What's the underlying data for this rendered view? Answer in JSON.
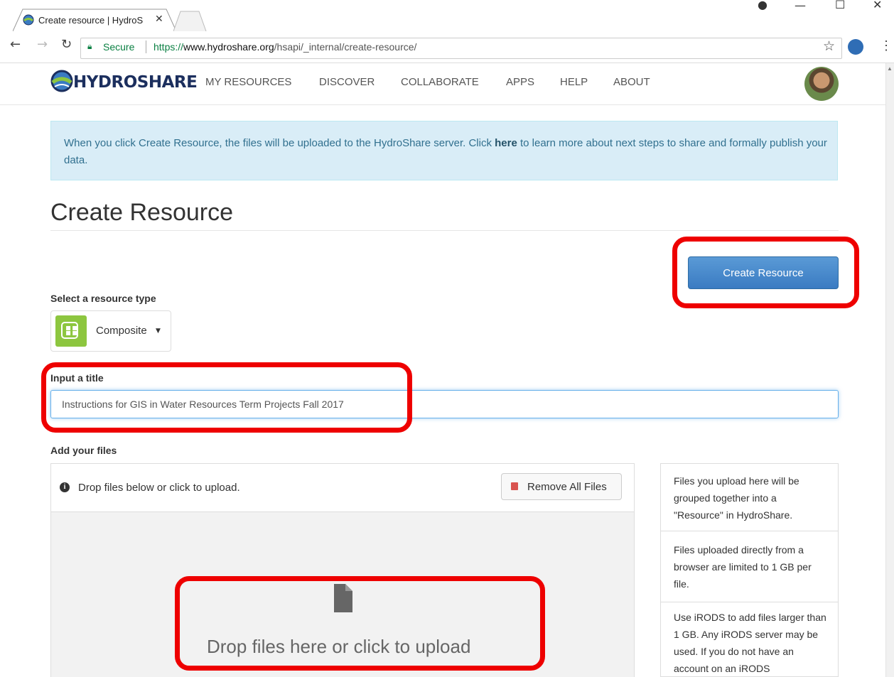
{
  "browser": {
    "tab_title": "Create resource | HydroS",
    "address_secure_label": "Secure",
    "url_scheme": "https://",
    "url_host": "www.hydroshare.org",
    "url_path": "/hsapi/_internal/create-resource/"
  },
  "site": {
    "logo_text": "HYDROSHARE",
    "nav": [
      "MY RESOURCES",
      "DISCOVER",
      "COLLABORATE",
      "APPS",
      "HELP",
      "ABOUT"
    ]
  },
  "alert": {
    "before_link": "When you click Create Resource, the files will be uploaded to the HydroShare server. Click ",
    "link": "here",
    "after_link": " to learn more about next steps to share and formally publish your data."
  },
  "page": {
    "title": "Create Resource",
    "create_button": "Create Resource",
    "resource_type_label": "Select a resource type",
    "resource_type_value": "Composite",
    "title_label": "Input a title",
    "title_value": "Instructions for GIS in Water Resources Term Projects Fall 2017",
    "files_label": "Add your files",
    "drop_hint": "Drop files below or click to upload.",
    "remove_all": "Remove All Files",
    "dropzone_text": "Drop files here or click to upload"
  },
  "side_notes": [
    "Files you upload here will be grouped together into a \"Resource\" in HydroShare.",
    "Files uploaded directly from a browser are limited to 1 GB per file.",
    "Use iRODS to add files larger than 1 GB. Any iRODS server may be used. If you do not have an account on an iRODS"
  ],
  "colors": {
    "highlight": "#ee0000",
    "primary_button": "#3a7bc2",
    "alert_bg": "#d9edf7",
    "composite_icon": "#8dc63f"
  },
  "icons": [
    "profile-icon",
    "minimize-icon",
    "maximize-icon",
    "close-icon",
    "back-icon",
    "forward-icon",
    "reload-icon",
    "lock-icon",
    "star-icon",
    "extension-icon",
    "menu-icon",
    "info-icon",
    "trash-icon",
    "file-icon"
  ]
}
